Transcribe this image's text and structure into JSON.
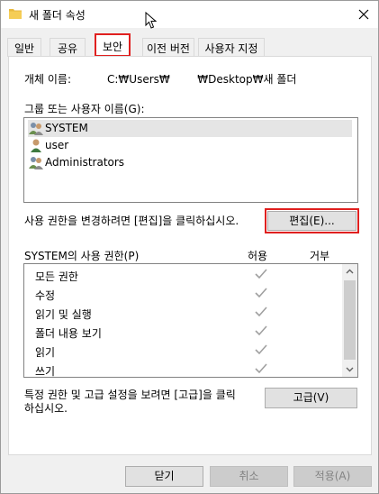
{
  "window": {
    "title": "새 폴더 속성"
  },
  "tabs": [
    {
      "label": "일반"
    },
    {
      "label": "공유"
    },
    {
      "label": "보안",
      "active": true
    },
    {
      "label": "이전 버전"
    },
    {
      "label": "사용자 지정"
    }
  ],
  "security": {
    "object_name_label": "개체 이름:",
    "object_name_value": "C:₩Users₩        ₩Desktop₩새 폴더",
    "groups_label": "그룹 또는 사용자 이름(G):",
    "users": [
      {
        "name": "SYSTEM",
        "icon": "group-users-icon",
        "selected": true
      },
      {
        "name": "user",
        "icon": "single-user-icon",
        "selected": false
      },
      {
        "name": "Administrators",
        "icon": "group-users-icon",
        "selected": false
      }
    ],
    "edit_hint": "사용 권한을 변경하려면 [편집]을 클릭하십시오.",
    "edit_button": "편집(E)...",
    "permissions_label": "SYSTEM의 사용 권한(P)",
    "allow_header": "허용",
    "deny_header": "거부",
    "permissions": [
      {
        "name": "모든 권한",
        "allow": true,
        "deny": false
      },
      {
        "name": "수정",
        "allow": true,
        "deny": false
      },
      {
        "name": "읽기 및 실행",
        "allow": true,
        "deny": false
      },
      {
        "name": "폴더 내용 보기",
        "allow": true,
        "deny": false
      },
      {
        "name": "읽기",
        "allow": true,
        "deny": false
      },
      {
        "name": "쓰기",
        "allow": true,
        "deny": false
      }
    ],
    "advanced_hint_line1": "특정 권한 및 고급 설정을 보려면 [고급]을 클릭",
    "advanced_hint_line2": "하십시오.",
    "advanced_button": "고급(V)"
  },
  "footer": {
    "close_button": "닫기",
    "cancel_button": "취소",
    "apply_button": "적용(A)"
  },
  "colors": {
    "highlight_red": "#e0201f",
    "checkmark_gray": "#a0a0a0"
  }
}
